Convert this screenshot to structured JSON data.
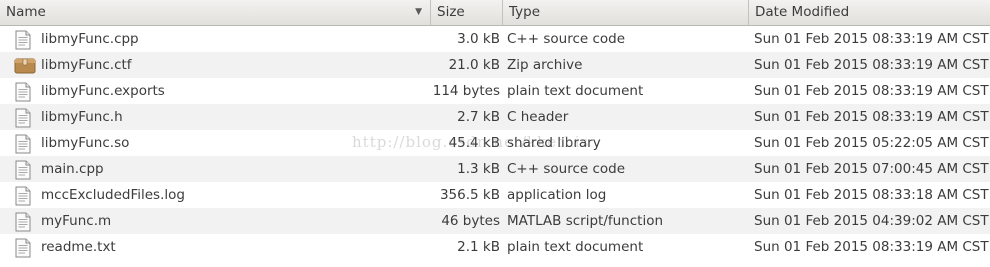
{
  "columns": {
    "name": "Name",
    "size": "Size",
    "type": "Type",
    "date": "Date Modified",
    "sort_icon": "chevron-down-icon"
  },
  "files": [
    {
      "name": "libmyFunc.cpp",
      "size": "3.0 kB",
      "type": "C++ source code",
      "date": "Sun 01 Feb 2015 08:33:19 AM CST",
      "icon": "text-file-icon"
    },
    {
      "name": "libmyFunc.ctf",
      "size": "21.0 kB",
      "type": "Zip archive",
      "date": "Sun 01 Feb 2015 08:33:19 AM CST",
      "icon": "archive-icon"
    },
    {
      "name": "libmyFunc.exports",
      "size": "114 bytes",
      "type": "plain text document",
      "date": "Sun 01 Feb 2015 08:33:19 AM CST",
      "icon": "text-file-icon"
    },
    {
      "name": "libmyFunc.h",
      "size": "2.7 kB",
      "type": "C header",
      "date": "Sun 01 Feb 2015 08:33:19 AM CST",
      "icon": "text-file-icon"
    },
    {
      "name": "libmyFunc.so",
      "size": "45.4 kB",
      "type": "shared library",
      "date": "Sun 01 Feb 2015 05:22:05 AM CST",
      "icon": "text-file-icon"
    },
    {
      "name": "main.cpp",
      "size": "1.3 kB",
      "type": "C++ source code",
      "date": "Sun 01 Feb 2015 07:00:45 AM CST",
      "icon": "text-file-icon"
    },
    {
      "name": "mccExcludedFiles.log",
      "size": "356.5 kB",
      "type": "application log",
      "date": "Sun 01 Feb 2015 08:33:18 AM CST",
      "icon": "text-file-icon"
    },
    {
      "name": "myFunc.m",
      "size": "46 bytes",
      "type": "MATLAB script/function",
      "date": "Sun 01 Feb 2015 04:39:02 AM CST",
      "icon": "text-file-icon"
    },
    {
      "name": "readme.txt",
      "size": "2.1 kB",
      "type": "plain text document",
      "date": "Sun 01 Feb 2015 08:33:19 AM CST",
      "icon": "text-file-icon"
    }
  ],
  "watermark": "http://blog.csdn.net/kkethis",
  "colors": {
    "alt_row": "#f2f2f2",
    "archive_icon": "#b98a4e",
    "text": "#3c3c3c"
  }
}
